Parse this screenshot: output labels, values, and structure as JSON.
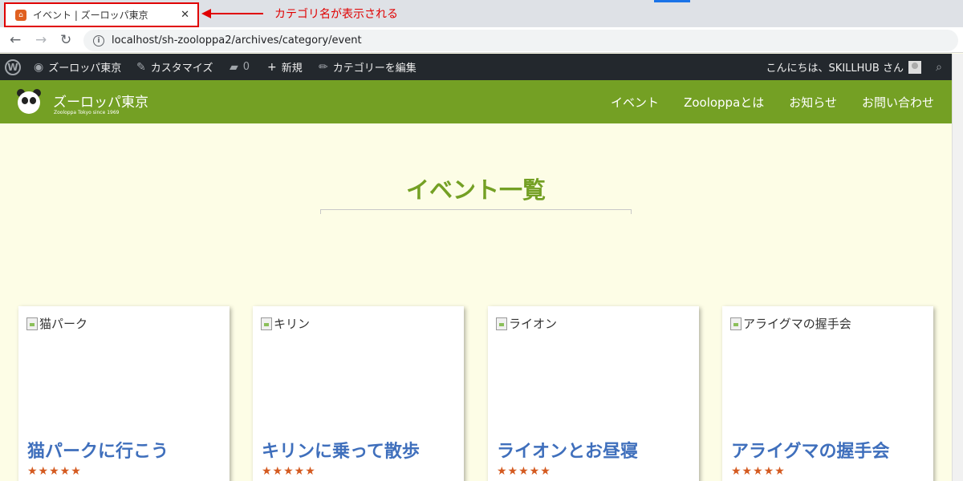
{
  "browser": {
    "tab_title": "イベント | ズーロッパ東京",
    "tab_close": "✕",
    "url": "localhost/sh-zooloppa2/archives/category/event",
    "annotation": "カテゴリ名が表示される"
  },
  "adminbar": {
    "site": "ズーロッパ東京",
    "customize": "カスタマイズ",
    "comments_count": "0",
    "new": "新規",
    "edit_category": "カテゴリーを編集",
    "greeting": "こんにちは、SKILLHUB さん"
  },
  "site": {
    "title": "ズーロッパ東京",
    "tagline": "Zooloppa Tokyo since 1969",
    "nav": [
      "イベント",
      "Zooloppaとは",
      "お知らせ",
      "お問い合わせ"
    ]
  },
  "page": {
    "title": "イベント一覧"
  },
  "cards": [
    {
      "img_alt": "猫パーク",
      "title": "猫パークに行こう",
      "rating": "★★★★★"
    },
    {
      "img_alt": "キリン",
      "title": "キリンに乗って散歩",
      "rating": "★★★★★"
    },
    {
      "img_alt": "ライオン",
      "title": "ライオンとお昼寝",
      "rating": "★★★★★"
    },
    {
      "img_alt": "アライグマの握手会",
      "title": "アライグマの握手会",
      "rating": "★★★★★"
    }
  ],
  "colors": {
    "accent_green": "#74a024",
    "page_bg": "#fdfde6",
    "card_title_blue": "#3f6fbc",
    "star_orange": "#d45a20",
    "annotation_red": "#e00000"
  }
}
